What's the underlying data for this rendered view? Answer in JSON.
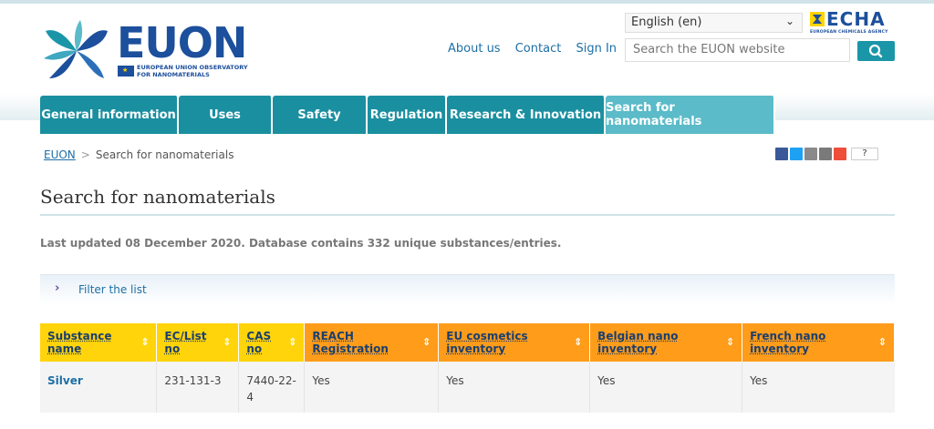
{
  "header": {
    "logo_text": "EUON",
    "logo_tagline": "EUROPEAN UNION OBSERVATORY FOR NANOMATERIALS",
    "links": [
      "About us",
      "Contact",
      "Sign In"
    ],
    "language": "English (en)",
    "echa_logo_text": "ECHA",
    "echa_tagline": "EUROPEAN CHEMICALS AGENCY",
    "search_placeholder": "Search the EUON website"
  },
  "nav": {
    "items": [
      {
        "label": "General information"
      },
      {
        "label": "Uses"
      },
      {
        "label": "Safety"
      },
      {
        "label": "Regulation"
      },
      {
        "label": "Research & Innovation"
      },
      {
        "label": "Search for nanomaterials",
        "active": true
      }
    ]
  },
  "breadcrumb": {
    "root": "EUON",
    "separator": ">",
    "current": "Search for nanomaterials"
  },
  "share": {
    "help_label": "?",
    "colors": [
      "#3b5998",
      "#1da1f2",
      "#8a8a8a",
      "#7a7a7a",
      "#ee4e3a"
    ]
  },
  "page": {
    "title": "Search for nanomaterials",
    "updated": "Last updated 08 December 2020. Database contains 332 unique substances/entries.",
    "filter_label": "Filter the list"
  },
  "table": {
    "headers": [
      {
        "label": "Substance name",
        "color": "#ffd40a"
      },
      {
        "label": "EC/List no",
        "color": "#ffd40a"
      },
      {
        "label": "CAS no",
        "color": "#ffd40a"
      },
      {
        "label": "REACH Registration",
        "color": "#ff9c1a"
      },
      {
        "label": "EU cosmetics inventory",
        "color": "#ff9c1a"
      },
      {
        "label": "Belgian nano inventory",
        "color": "#ff9c1a"
      },
      {
        "label": "French nano inventory",
        "color": "#ff9c1a"
      }
    ],
    "rows": [
      {
        "cells": [
          "Silver",
          "231-131-3",
          "7440-22-4",
          "Yes",
          "Yes",
          "Yes",
          "Yes"
        ]
      }
    ]
  }
}
